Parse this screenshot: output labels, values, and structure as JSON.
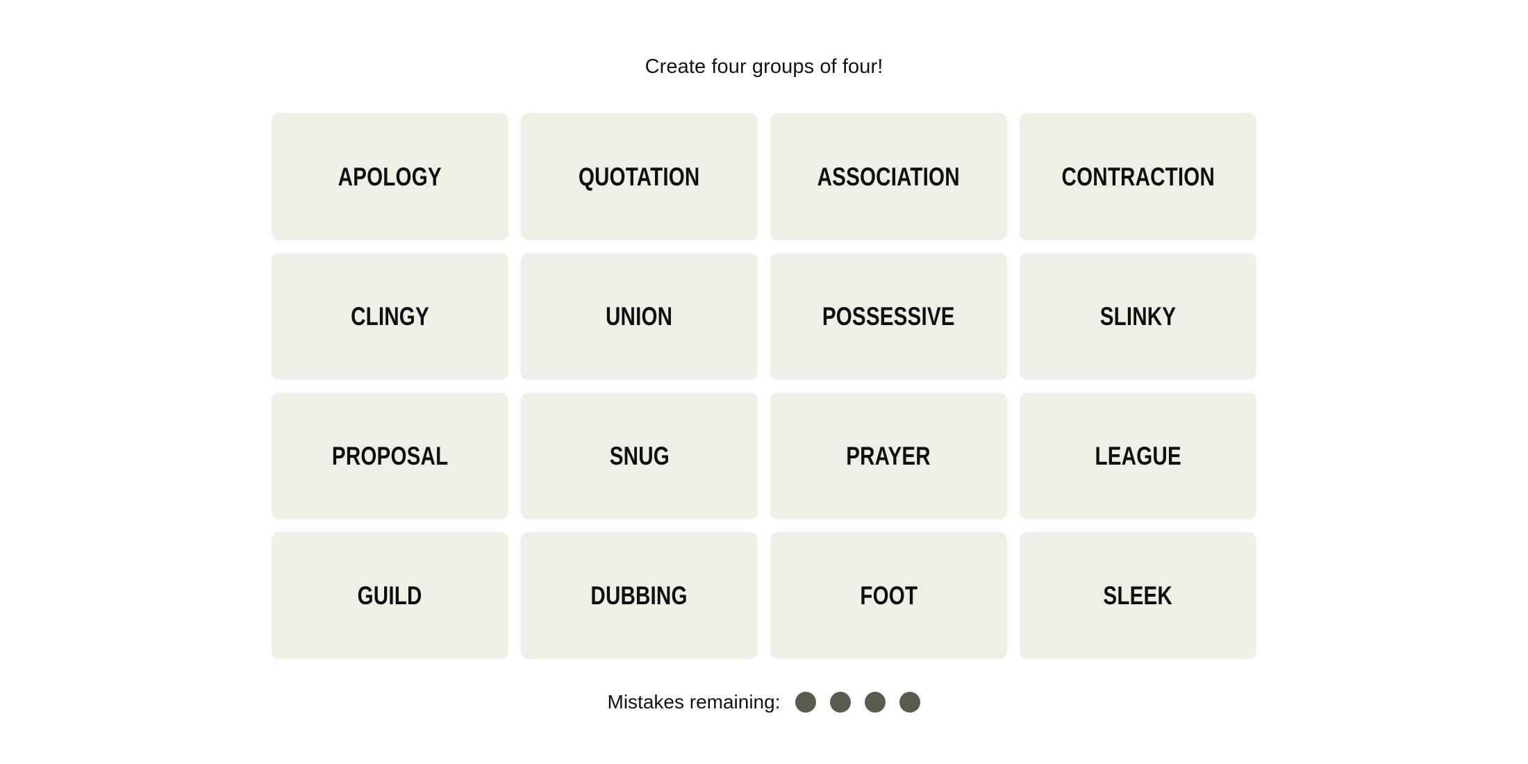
{
  "game": {
    "prompt": "Create four groups of four!",
    "board": {
      "rows": [
        [
          "APOLOGY",
          "QUOTATION",
          "ASSOCIATION",
          "CONTRACTION"
        ],
        [
          "CLINGY",
          "UNION",
          "POSSESSIVE",
          "SLINKY"
        ],
        [
          "PROPOSAL",
          "SNUG",
          "PRAYER",
          "LEAGUE"
        ],
        [
          "GUILD",
          "DUBBING",
          "FOOT",
          "SLEEK"
        ]
      ],
      "tiles": [
        "APOLOGY",
        "QUOTATION",
        "ASSOCIATION",
        "CONTRACTION",
        "CLINGY",
        "UNION",
        "POSSESSIVE",
        "SLINKY",
        "PROPOSAL",
        "SNUG",
        "PRAYER",
        "LEAGUE",
        "GUILD",
        "DUBBING",
        "FOOT",
        "SLEEK"
      ]
    },
    "mistakes": {
      "label": "Mistakes remaining:",
      "remaining": 4,
      "dots": [
        "dot",
        "dot",
        "dot",
        "dot"
      ]
    },
    "colors": {
      "page_background": "#ffffff",
      "tile_background": "#efefe6",
      "tile_text": "#0f0f0f",
      "prompt_text": "#121212",
      "mistake_dot": "#5a5a4e"
    }
  }
}
